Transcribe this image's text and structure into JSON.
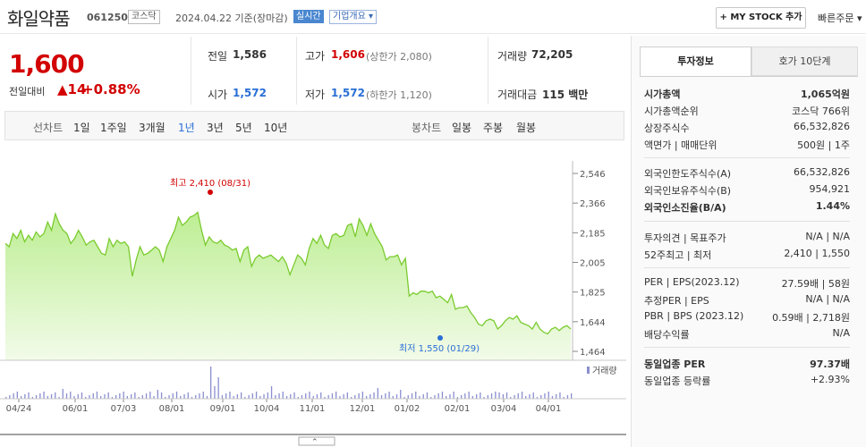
{
  "header": {
    "stock_name": "화일약품",
    "code": "061250",
    "market": "코스닥",
    "date": "2024.04.22 기준(장마감)",
    "live_badge": "실시간",
    "corp_info": "기업개요 ▾",
    "mystock_button": "+ MY STOCK 추가",
    "quick_order": "빠른주문 ▾"
  },
  "price": {
    "current": "1,600",
    "change_label": "전일대비",
    "change_arrow": "▲",
    "change": "14",
    "change_pct": "+0.88%"
  },
  "quote": {
    "prev_label": "전일",
    "prev": "1,586",
    "high_label": "고가",
    "high": "1,606",
    "upper_limit": "(상한가 2,080)",
    "volume_label": "거래량",
    "volume": "72,205",
    "open_label": "시가",
    "open": "1,572",
    "low_label": "저가",
    "low": "1,572",
    "lower_limit": "(하한가 1,120)",
    "amount_label": "거래대금",
    "amount": "115 백만"
  },
  "period_tabs": {
    "line_chart": "선차트",
    "items": [
      "1일",
      "1주일",
      "3개월",
      "1년",
      "3년",
      "5년",
      "10년"
    ],
    "active": "1년",
    "candle_chart": "봉차트",
    "candle_items": [
      "일봉",
      "주봉",
      "월봉"
    ]
  },
  "chart_data": {
    "type": "area",
    "y_ticks": [
      "2,546",
      "2,366",
      "2,185",
      "2,005",
      "1,825",
      "1,644",
      "1,464"
    ],
    "ylim": [
      1464,
      2546
    ],
    "x_ticks": [
      "04/24",
      "06/01",
      "07/03",
      "08/01",
      "09/01",
      "10/04",
      "11/01",
      "12/01",
      "01/02",
      "02/01",
      "03/04",
      "04/01"
    ],
    "max_annotation": "최고 2,410 (08/31)",
    "min_annotation": "최저 1,550 (01/29)",
    "volume_legend": "거래량",
    "series": [
      {
        "values": [
          2120,
          2100,
          2180,
          2150,
          2200,
          2130,
          2170,
          2140,
          2190,
          2160,
          2180,
          2250,
          2200,
          2300,
          2240,
          2200,
          2180,
          2120,
          2150,
          2200,
          2160,
          2110,
          2130,
          2140,
          2100,
          2060,
          2050,
          2150,
          2100,
          2140,
          2120,
          2130,
          2100,
          1920,
          2020,
          2100,
          2050,
          2060,
          2080,
          2100,
          2080,
          2010,
          2100,
          2150,
          2200,
          2280,
          2230,
          2250,
          2280,
          2290,
          2310,
          2200,
          2110,
          2160,
          2130,
          2120,
          2140,
          2110,
          2100,
          2080,
          2090,
          2010,
          2080,
          2100,
          1980,
          2030,
          2050,
          2030,
          2040,
          2050,
          2030,
          2010,
          2040,
          2000,
          1930,
          1990,
          2050,
          2030,
          1990,
          2090,
          2150,
          2120,
          2170,
          2110,
          2090,
          2170,
          2180,
          2160,
          2170,
          2230,
          2240,
          2160,
          2270,
          2230,
          2170,
          2240,
          2180,
          2140,
          2100,
          2020,
          2040,
          2040,
          2050,
          1990,
          2030,
          1800,
          1820,
          1810,
          1830,
          1830,
          1820,
          1830,
          1790,
          1800,
          1780,
          1760,
          1810,
          1720,
          1730,
          1730,
          1740,
          1700,
          1670,
          1630,
          1620,
          1650,
          1660,
          1650,
          1600,
          1620,
          1650,
          1670,
          1660,
          1680,
          1640,
          1630,
          1620,
          1600,
          1640,
          1600,
          1580,
          1570,
          1600,
          1610,
          1590,
          1610,
          1620,
          1600
        ]
      }
    ]
  },
  "right_panel": {
    "tab_info": "투자정보",
    "tab_orderbook": "호가 10단계",
    "rows": [
      {
        "label": "시가총액",
        "value": "1,065억원"
      },
      {
        "label": "시가총액순위",
        "value": "코스닥 766위"
      },
      {
        "label": "상장주식수",
        "value": "66,532,826"
      },
      {
        "label": "액면가 | 매매단위",
        "value": "500원 | 1주"
      },
      {
        "label": "외국인한도주식수(A)",
        "value": "66,532,826"
      },
      {
        "label": "외국인보유주식수(B)",
        "value": "954,921"
      },
      {
        "label": "외국인소진율(B/A)",
        "value": "1.44%"
      },
      {
        "label": "투자의견 | 목표주가",
        "value": "N/A | N/A"
      },
      {
        "label": "52주최고 | 최저",
        "value": "2,410 | 1,550"
      },
      {
        "label": "PER | EPS(2023.12)",
        "value": "27.59배 | 58원"
      },
      {
        "label": "추정PER | EPS",
        "value": "N/A | N/A"
      },
      {
        "label": "PBR | BPS (2023.12)",
        "value": "0.59배 | 2,718원"
      },
      {
        "label": "배당수익률",
        "value": "N/A"
      },
      {
        "label": "동일업종 PER",
        "value": "97.37배"
      },
      {
        "label": "동일업종 등락률",
        "value": "+2.93%"
      }
    ]
  },
  "colors": {
    "up": "#d20000",
    "down": "#2a6fd6",
    "area_fill": "#c9f0a8",
    "area_line": "#7acb2f"
  }
}
